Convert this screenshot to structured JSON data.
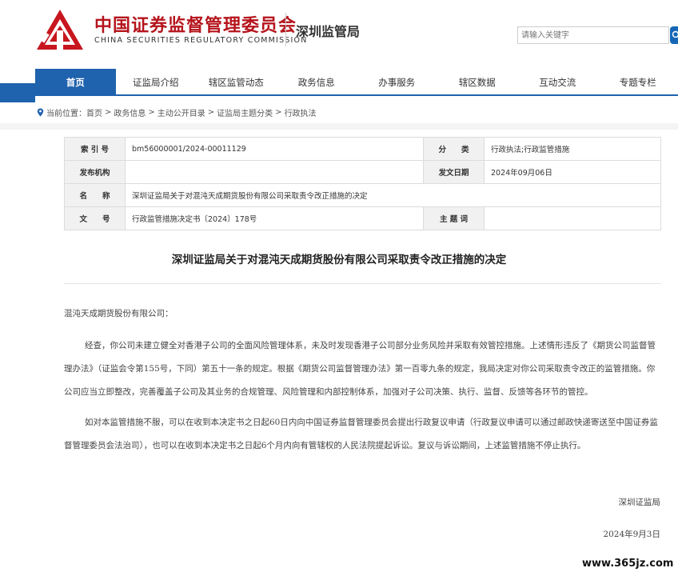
{
  "header": {
    "brand_cn": "中国证券监督管理委员会",
    "brand_en": "CHINA SECURITIES REGULATORY COMMISSION",
    "bureau": "深圳监管局",
    "search_placeholder": "请输入关键字",
    "brand_color": "#b5141c",
    "accent_color": "#1f62ad"
  },
  "nav": {
    "items": [
      {
        "label": "首页"
      },
      {
        "label": "证监局介绍"
      },
      {
        "label": "辖区监管动态"
      },
      {
        "label": "政务信息"
      },
      {
        "label": "办事服务"
      },
      {
        "label": "辖区数据"
      },
      {
        "label": "互动交流"
      },
      {
        "label": "专题专栏"
      }
    ]
  },
  "breadcrumb": {
    "prefix": "当前位置：",
    "items": [
      "首页",
      "政务信息",
      "主动公开目录",
      "证监局主题分类",
      "行政执法"
    ],
    "separator": ">"
  },
  "info": {
    "index_label": "索 引 号",
    "index_value": "bm56000001/2024-00011129",
    "category_label": "分　　类",
    "category_value": "行政执法;行政监管措施",
    "publisher_label": "发布机构",
    "publisher_value": "",
    "date_label": "发文日期",
    "date_value": "2024年09月06日",
    "name_label": "名　　称",
    "name_value": "深圳证监局关于对混沌天成期货股份有限公司采取责令改正措施的决定",
    "doc_label": "文　　号",
    "doc_value": "行政监管措施决定书〔2024〕178号",
    "subject_label": "主 题 词",
    "subject_value": ""
  },
  "document": {
    "title": "深圳证监局关于对混沌天成期货股份有限公司采取责令改正措施的决定",
    "addressee": "混沌天成期货股份有限公司：",
    "paragraph1": "经查，你公司未建立健全对香港子公司的全面风险管理体系，未及时发现香港子公司部分业务风险并采取有效管控措施。上述情形违反了《期货公司监督管理办法》（证监会令第155号，下同）第五十一条的规定。根据《期货公司监督管理办法》第一百零九条的规定，我局决定对你公司采取责令改正的监管措施。你公司应当立即整改，完善覆盖子公司及其业务的合规管理、风险管理和内部控制体系，加强对子公司决策、执行、监督、反馈等各环节的管控。",
    "paragraph2": "如对本监管措施不服，可以在收到本决定书之日起60日内向中国证券监督管理委员会提出行政复议申请（行政复议申请可以通过邮政快递寄送至中国证券监督管理委员会法治司），也可以在收到本决定书之日起6个月内向有管辖权的人民法院提起诉讼。复议与诉讼期间，上述监管措施不停止执行。",
    "signature": "深圳证监局",
    "date": "2024年9月3日"
  },
  "watermark": "www.365jz.com"
}
